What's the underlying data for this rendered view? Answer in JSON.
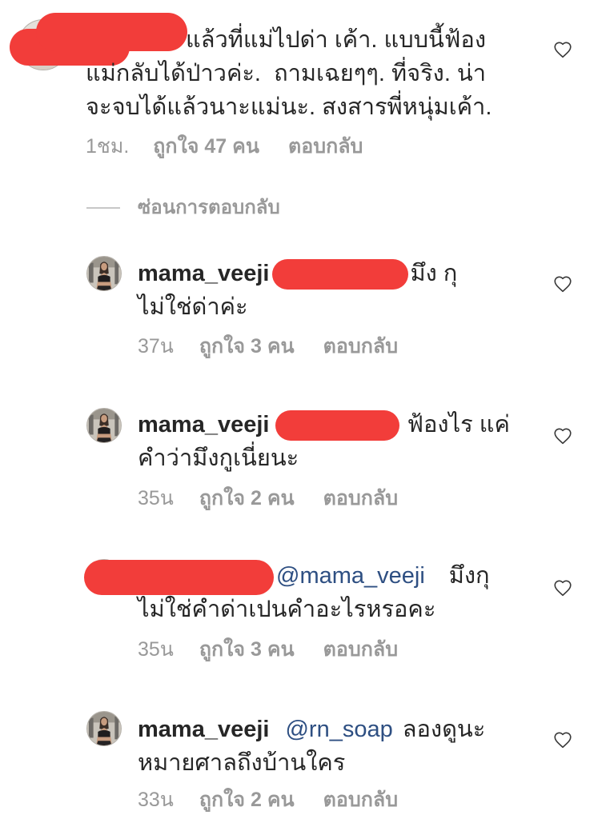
{
  "parent_comment": {
    "text_lines": [
      "แล้วที่แม่ไปด่า เค้า. แบบนี้ฟ้อง",
      "แม่กลับได้ป่าวค่ะ.  ถามเฉยๆๆ. ที่จริง. น่า",
      "จะจบได้แล้วนาะแม่นะ. สงสารพี่หนุ่มเค้า."
    ],
    "time": "1ชม.",
    "likes": "ถูกใจ 47 คน",
    "reply_label": "ตอบกลับ"
  },
  "hide_replies_label": "ซ่อนการตอบกลับ",
  "replies": [
    {
      "username": "mama_veeji",
      "text_line1": "มึง กุ",
      "text_line2": "ไม่ใช่ด่าค่ะ",
      "time": "37น",
      "likes": "ถูกใจ 3 คน",
      "reply_label": "ตอบกลับ"
    },
    {
      "username": "mama_veeji",
      "text_line1": "ฟ้องไร แค่",
      "text_line2": "คำว่ามึงกูเนี่ยนะ",
      "time": "35น",
      "likes": "ถูกใจ 2 คน",
      "reply_label": "ตอบกลับ"
    },
    {
      "mention": "@mama_veeji",
      "text_line1": "มึงกุ",
      "text_line2": "ไม่ใช่คำด่าเปนคำอะไรหรอคะ",
      "time": "35น",
      "likes": "ถูกใจ 3 คน",
      "reply_label": "ตอบกลับ"
    },
    {
      "username": "mama_veeji",
      "mention": "@rn_soap",
      "text_line1": "ลองดูนะ",
      "text_line2": "หมายศาลถึงบ้านใคร",
      "time": "33น",
      "likes": "ถูกใจ 2 คน",
      "reply_label": "ตอบกลับ"
    }
  ],
  "icons": {
    "like_button": "heart-outline-icon",
    "profile_picture": "avatar"
  },
  "colors": {
    "text": "#262626",
    "meta": "#999999",
    "mention": "#2e4f82",
    "redaction": "#f23d3a",
    "divider": "#c7c7c7",
    "heart": "#3a3a3a"
  }
}
